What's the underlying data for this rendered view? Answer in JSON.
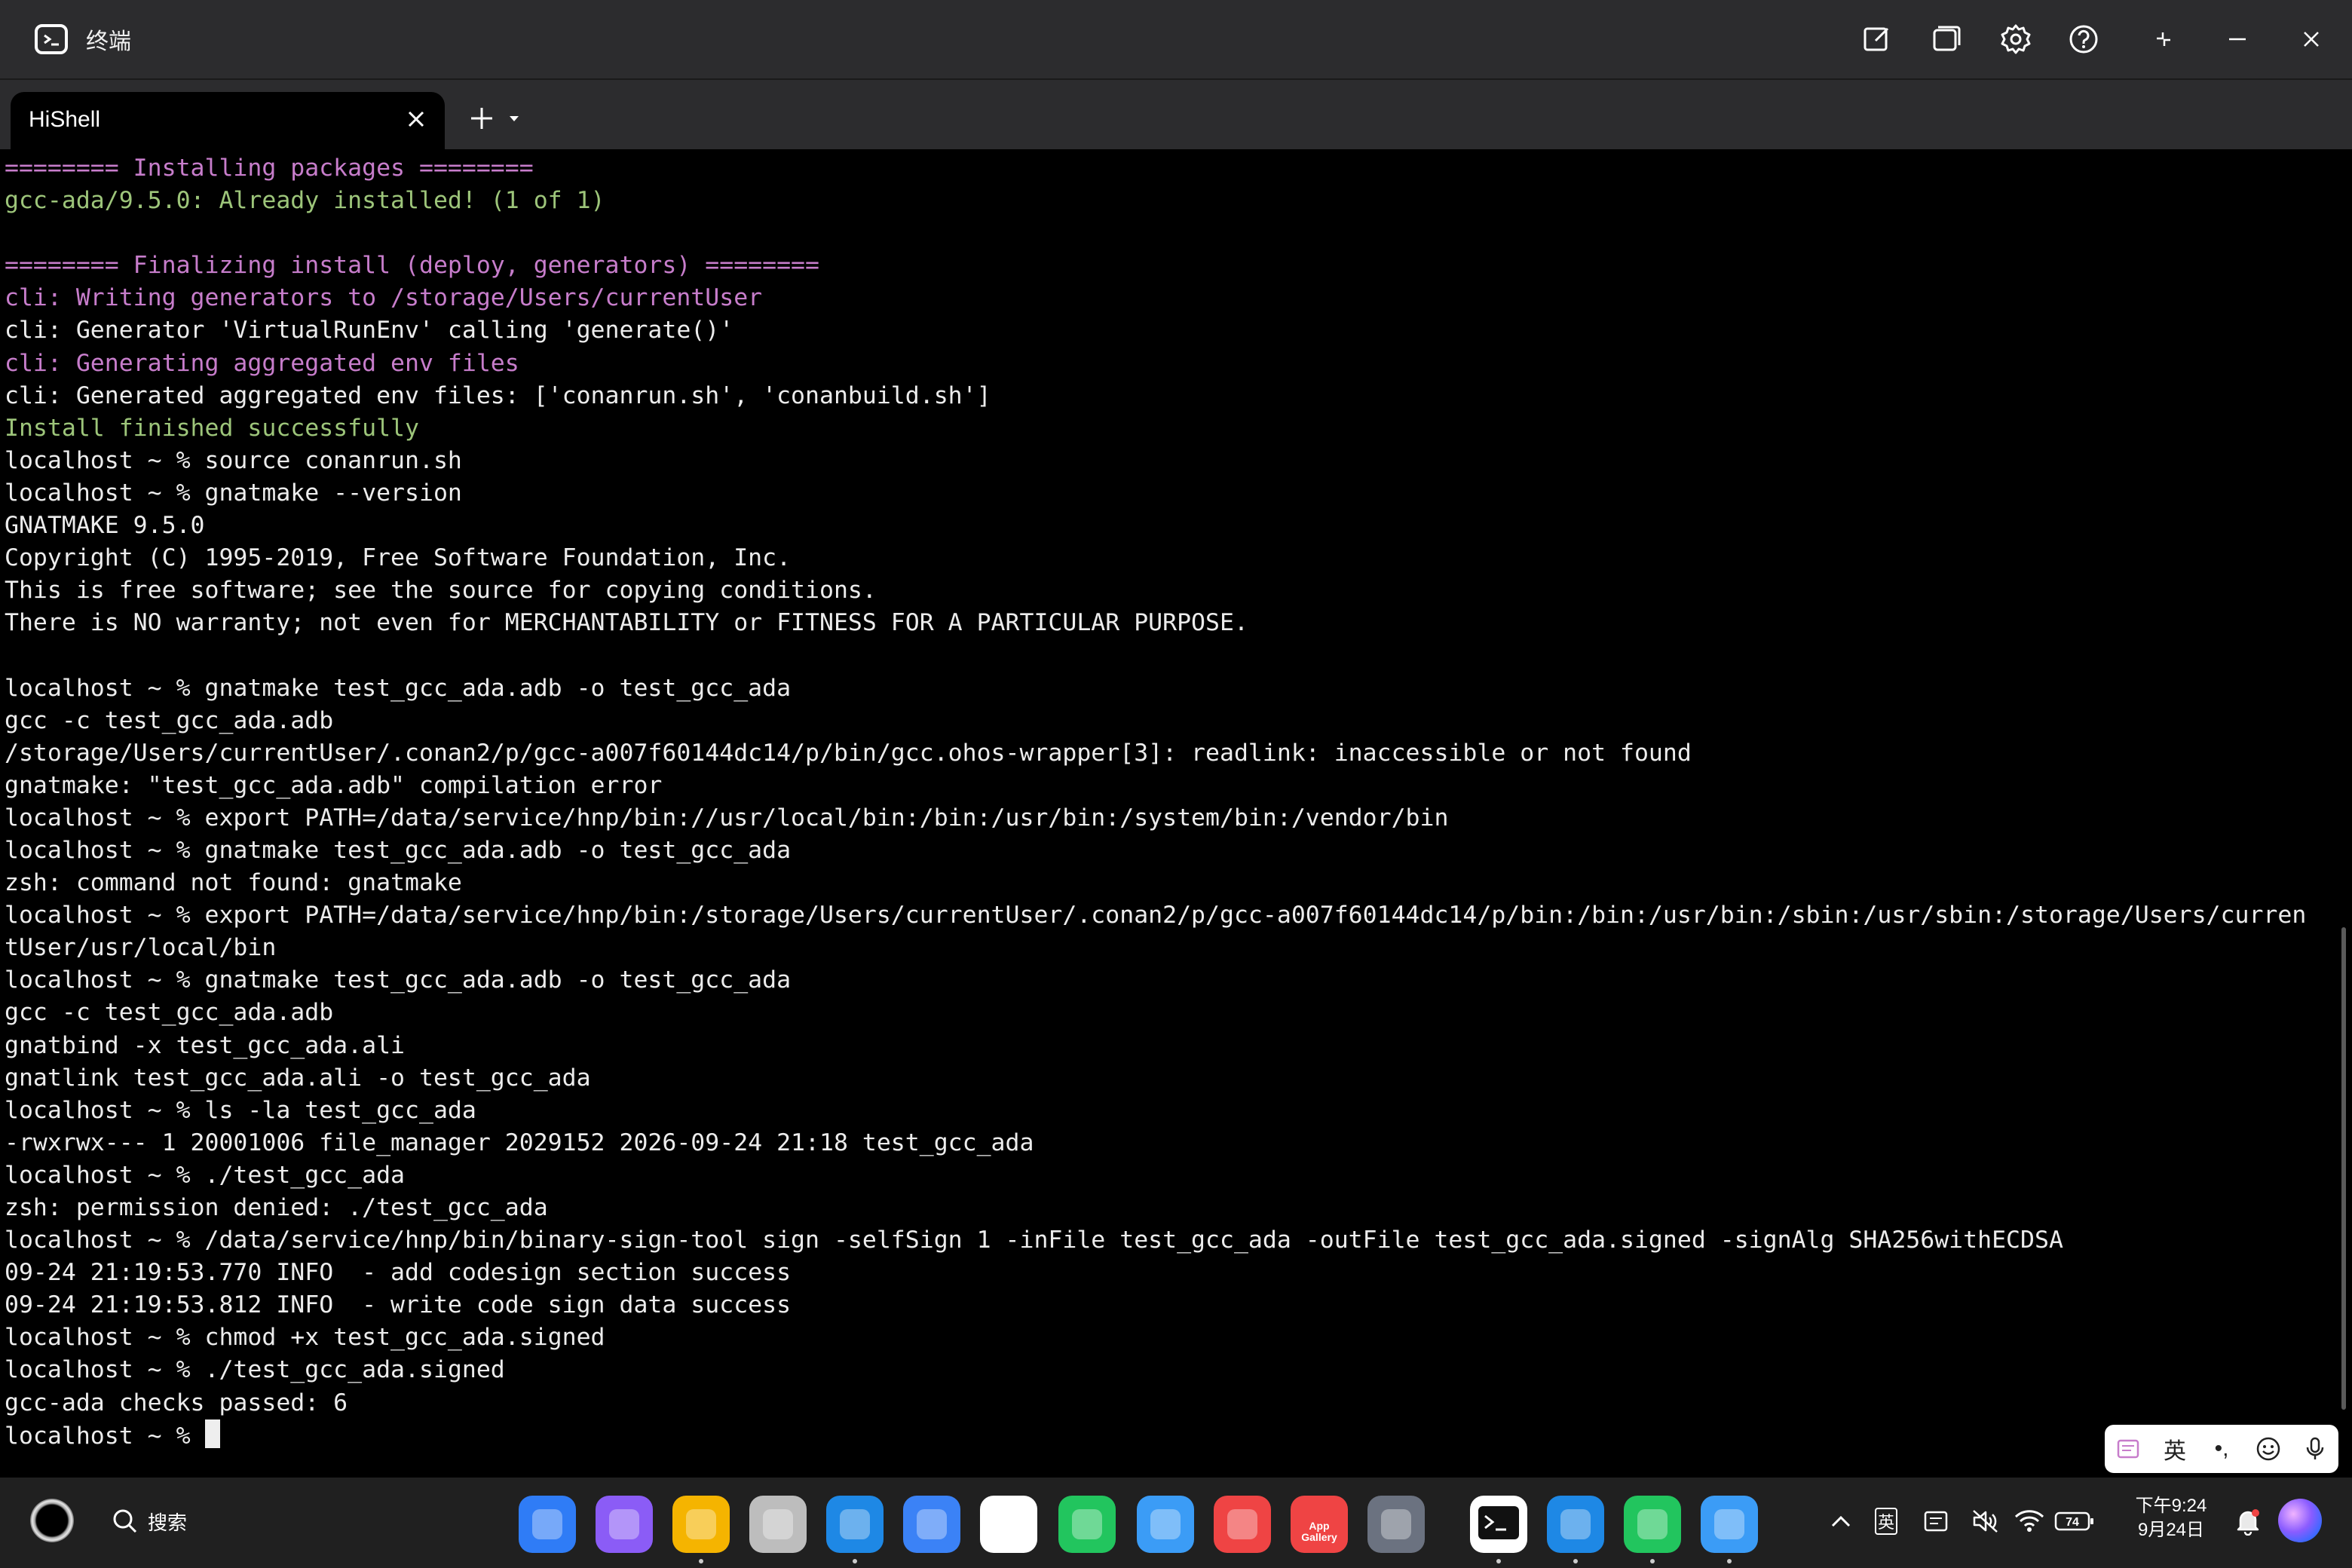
{
  "window": {
    "title": "终端",
    "icons": [
      "terminal-icon",
      "edit-icon",
      "multi-window-icon",
      "gear-icon",
      "help-icon",
      "restore-icon",
      "minimize-icon",
      "close-icon"
    ]
  },
  "tabs": [
    {
      "label": "HiShell",
      "active": true
    }
  ],
  "terminal": {
    "lines": [
      {
        "text": "======== Installing packages ========",
        "color": "magenta"
      },
      {
        "text": "gcc-ada/9.5.0: Already installed! (1 of 1)",
        "color": "green"
      },
      {
        "text": "",
        "color": "white"
      },
      {
        "text": "======== Finalizing install (deploy, generators) ========",
        "color": "magenta"
      },
      {
        "text": "cli: Writing generators to /storage/Users/currentUser",
        "color": "magenta"
      },
      {
        "text": "cli: Generator 'VirtualRunEnv' calling 'generate()'",
        "color": "white"
      },
      {
        "text": "cli: Generating aggregated env files",
        "color": "magenta"
      },
      {
        "text": "cli: Generated aggregated env files: ['conanrun.sh', 'conanbuild.sh']",
        "color": "white"
      },
      {
        "text": "Install finished successfully",
        "color": "green"
      },
      {
        "text": "localhost ~ % source conanrun.sh",
        "color": "white"
      },
      {
        "text": "localhost ~ % gnatmake --version",
        "color": "white"
      },
      {
        "text": "GNATMAKE 9.5.0",
        "color": "white"
      },
      {
        "text": "Copyright (C) 1995-2019, Free Software Foundation, Inc.",
        "color": "white"
      },
      {
        "text": "This is free software; see the source for copying conditions.",
        "color": "white"
      },
      {
        "text": "There is NO warranty; not even for MERCHANTABILITY or FITNESS FOR A PARTICULAR PURPOSE.",
        "color": "white"
      },
      {
        "text": "",
        "color": "white"
      },
      {
        "text": "localhost ~ % gnatmake test_gcc_ada.adb -o test_gcc_ada",
        "color": "white"
      },
      {
        "text": "gcc -c test_gcc_ada.adb",
        "color": "white"
      },
      {
        "text": "/storage/Users/currentUser/.conan2/p/gcc-a007f60144dc14/p/bin/gcc.ohos-wrapper[3]: readlink: inaccessible or not found",
        "color": "white"
      },
      {
        "text": "gnatmake: \"test_gcc_ada.adb\" compilation error",
        "color": "white"
      },
      {
        "text": "localhost ~ % export PATH=/data/service/hnp/bin://usr/local/bin:/bin:/usr/bin:/system/bin:/vendor/bin",
        "color": "white"
      },
      {
        "text": "localhost ~ % gnatmake test_gcc_ada.adb -o test_gcc_ada",
        "color": "white"
      },
      {
        "text": "zsh: command not found: gnatmake",
        "color": "white"
      },
      {
        "text": "localhost ~ % export PATH=/data/service/hnp/bin:/storage/Users/currentUser/.conan2/p/gcc-a007f60144dc14/p/bin:/bin:/usr/bin:/sbin:/usr/sbin:/storage/Users/curren",
        "color": "white"
      },
      {
        "text": "tUser/usr/local/bin",
        "color": "white"
      },
      {
        "text": "localhost ~ % gnatmake test_gcc_ada.adb -o test_gcc_ada",
        "color": "white"
      },
      {
        "text": "gcc -c test_gcc_ada.adb",
        "color": "white"
      },
      {
        "text": "gnatbind -x test_gcc_ada.ali",
        "color": "white"
      },
      {
        "text": "gnatlink test_gcc_ada.ali -o test_gcc_ada",
        "color": "white"
      },
      {
        "text": "localhost ~ % ls -la test_gcc_ada",
        "color": "white"
      },
      {
        "text": "-rwxrwx--- 1 20001006 file_manager 2029152 2026-09-24 21:18 test_gcc_ada",
        "color": "white"
      },
      {
        "text": "localhost ~ % ./test_gcc_ada",
        "color": "white"
      },
      {
        "text": "zsh: permission denied: ./test_gcc_ada",
        "color": "white"
      },
      {
        "text": "localhost ~ % /data/service/hnp/bin/binary-sign-tool sign -selfSign 1 -inFile test_gcc_ada -outFile test_gcc_ada.signed -signAlg SHA256withECDSA",
        "color": "white"
      },
      {
        "text": "09-24 21:19:53.770 INFO  - add codesign section success",
        "color": "white"
      },
      {
        "text": "09-24 21:19:53.812 INFO  - write code sign data success",
        "color": "white"
      },
      {
        "text": "localhost ~ % chmod +x test_gcc_ada.signed",
        "color": "white"
      },
      {
        "text": "localhost ~ % ./test_gcc_ada.signed",
        "color": "white"
      },
      {
        "text": "gcc-ada checks passed: 6",
        "color": "white"
      }
    ],
    "prompt": "localhost ~ % "
  },
  "ime": {
    "language": "英",
    "punct": "•,",
    "icons": [
      "clipboard-icon",
      "emoji-icon",
      "microphone-icon"
    ]
  },
  "taskbar": {
    "search_label": "搜索",
    "apps": [
      {
        "name": "app-center",
        "color": "#2f7cf6"
      },
      {
        "name": "multitask",
        "color": "#8b5cf6"
      },
      {
        "name": "files",
        "color": "#f5b400"
      },
      {
        "name": "trash",
        "color": "#bdbdbd"
      },
      {
        "name": "browser",
        "color": "#1e88e5"
      },
      {
        "name": "mail",
        "color": "#3b82f6"
      },
      {
        "name": "gallery",
        "color": "#ffffff"
      },
      {
        "name": "messages",
        "color": "#22c55e"
      },
      {
        "name": "music",
        "color": "#3b9cf6"
      },
      {
        "name": "books",
        "color": "#ef4444"
      },
      {
        "name": "appgallery",
        "color": "#ef4444",
        "label": "App Gallery"
      },
      {
        "name": "settings",
        "color": "#6b7280"
      },
      {
        "name": "terminal",
        "color": "#ffffff"
      },
      {
        "name": "video",
        "color": "#1e88e5"
      },
      {
        "name": "wechat",
        "color": "#22c55e"
      },
      {
        "name": "file-manager",
        "color": "#3b9cf6"
      }
    ],
    "tray": {
      "input_lang": "英",
      "battery": "74"
    },
    "clock": {
      "time": "下午9:24",
      "date": "9月24日"
    }
  }
}
